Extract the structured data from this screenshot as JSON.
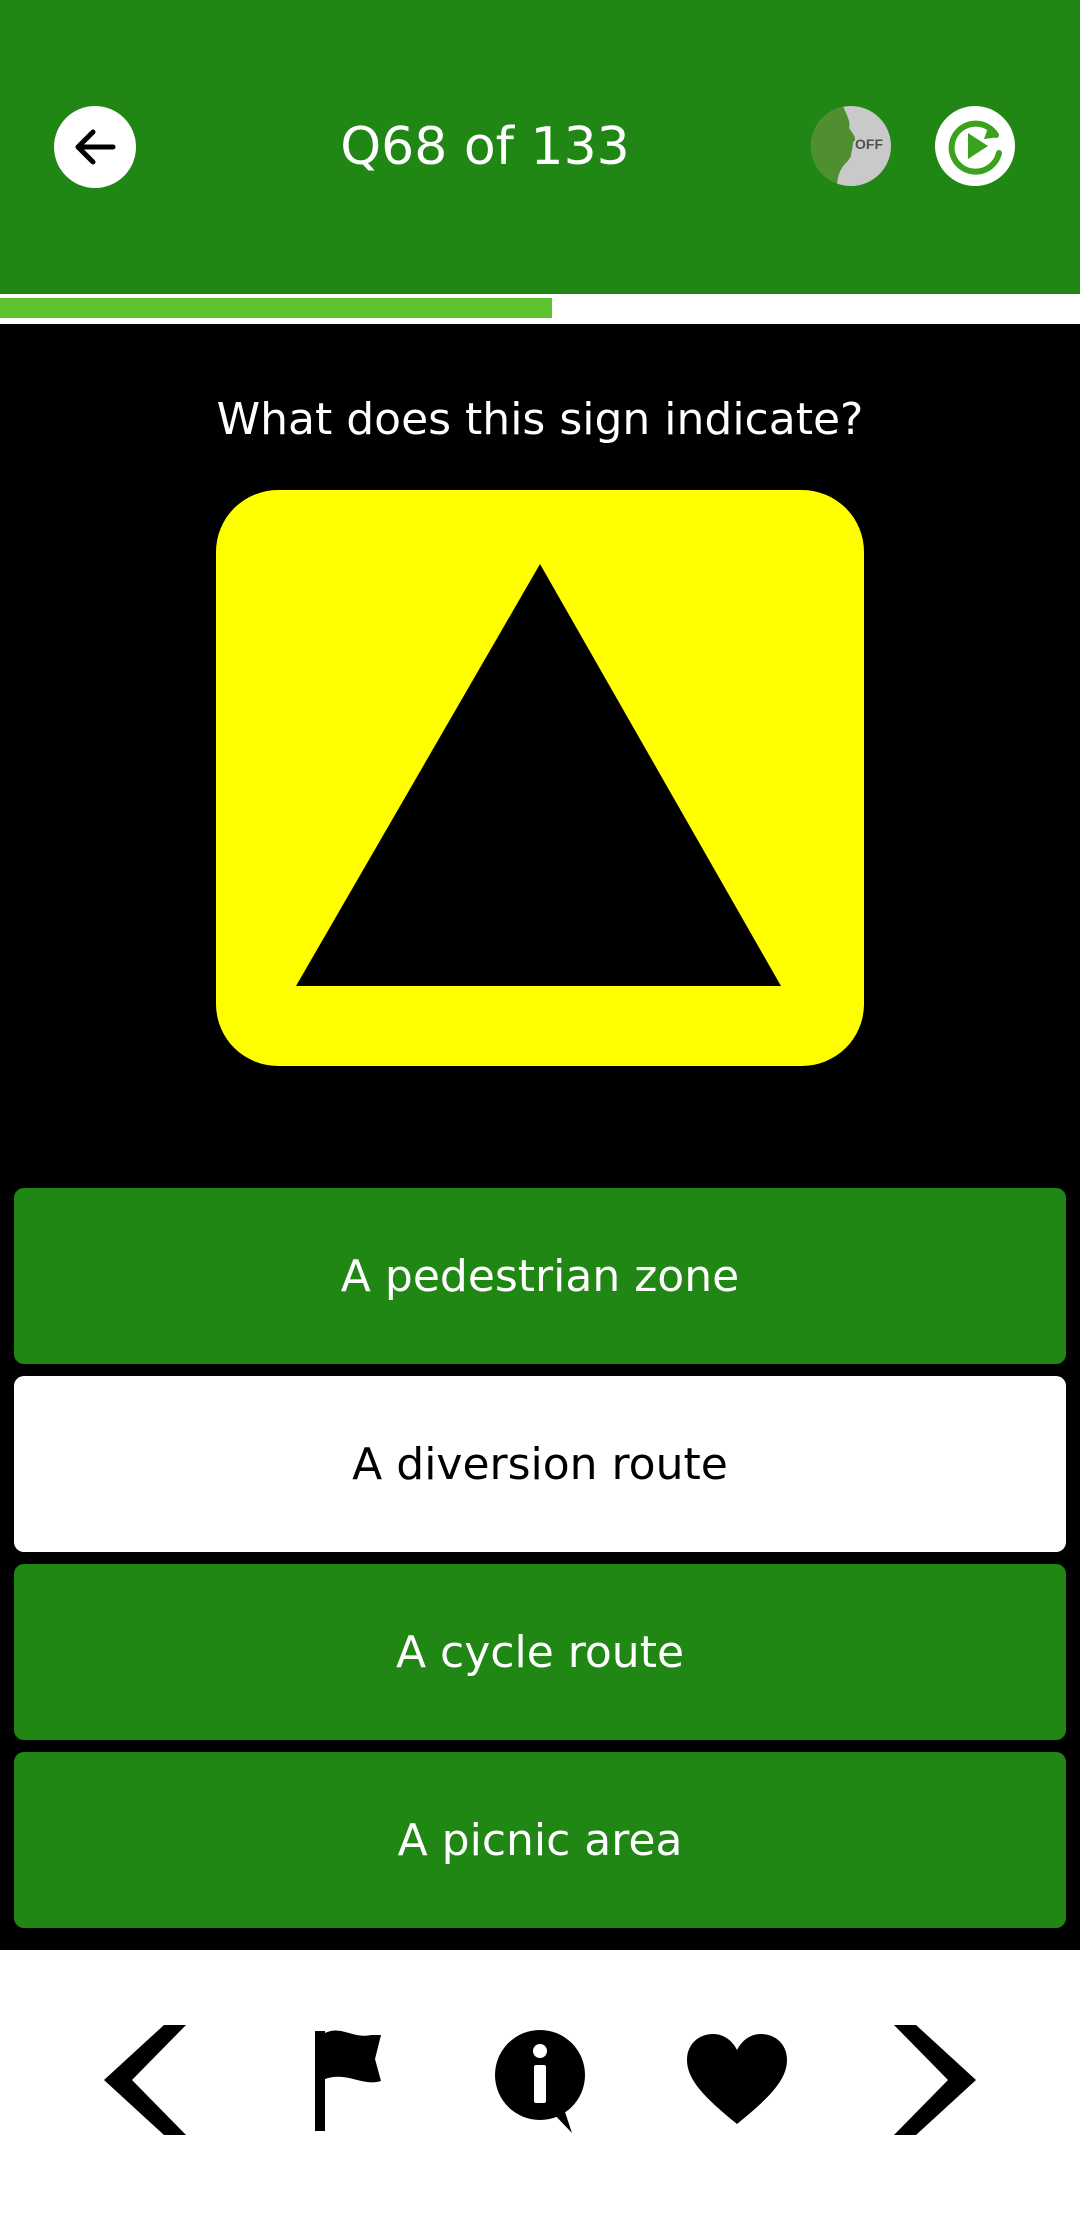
{
  "header": {
    "title": "Q68 of 133",
    "back_icon": "arrow-left-icon",
    "voice_toggle": {
      "icon": "voice-head-icon",
      "state_label": "OFF"
    },
    "replay_icon": "replay-icon"
  },
  "progress": {
    "fraction": 0.511
  },
  "question": {
    "text": "What does this sign indicate?",
    "sign": {
      "background": "#ffff00",
      "symbol": "black-triangle",
      "symbol_color": "#000000"
    }
  },
  "answers": [
    {
      "label": "A pedestrian zone",
      "selected": false
    },
    {
      "label": "A diversion route",
      "selected": true
    },
    {
      "label": "A cycle route",
      "selected": false
    },
    {
      "label": "A picnic area",
      "selected": false
    }
  ],
  "bottom_nav": [
    {
      "icon": "chevron-left-icon"
    },
    {
      "icon": "flag-icon"
    },
    {
      "icon": "info-icon"
    },
    {
      "icon": "heart-icon"
    },
    {
      "icon": "chevron-right-icon"
    }
  ],
  "colors": {
    "primary_green": "#208614",
    "progress_green": "#5ec42d",
    "sign_yellow": "#ffff00",
    "background": "#000000"
  }
}
